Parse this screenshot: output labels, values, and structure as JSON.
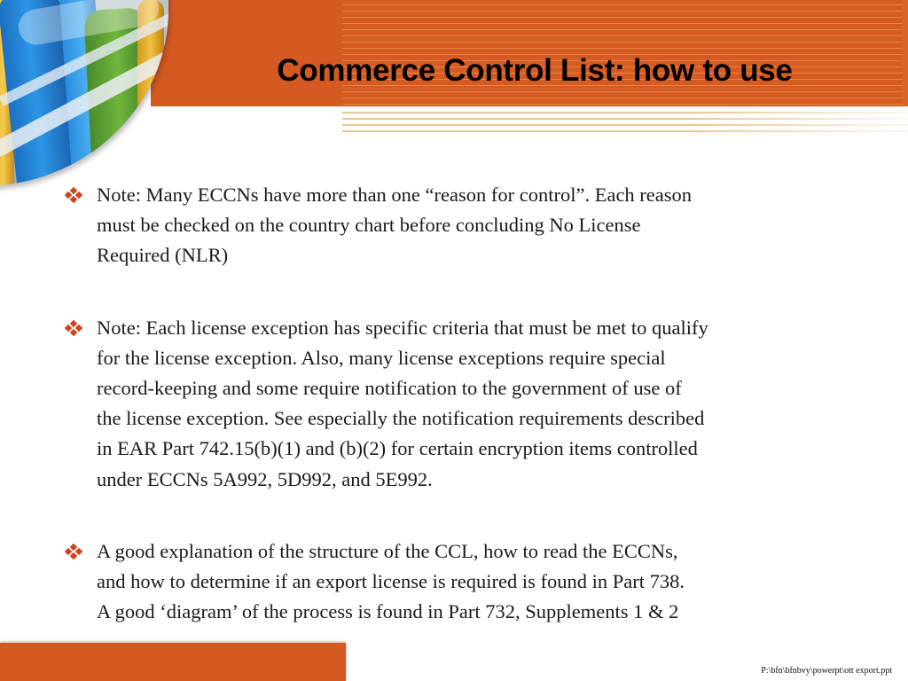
{
  "slide": {
    "title": "Commerce Control List: how to use",
    "accent_color": "#d45a22",
    "bullet_color": "#d0431f",
    "bullet_icon": "diamond-cluster-icon",
    "image": "test-tubes-photo",
    "bullets": [
      {
        "lines": [
          "Note: Many ECCNs have more than one “reason for control”.  Each reason",
          "must be checked on the country chart before concluding No License",
          "Required (NLR)"
        ]
      },
      {
        "lines": [
          "Note: Each license exception has specific criteria that must be met to qualify",
          "for the license exception.  Also, many license exceptions require special",
          "record-keeping and some require notification to the government of use of",
          "the license exception.  See especially the notification requirements described",
          "in EAR Part 742.15(b)(1) and (b)(2) for certain encryption items controlled",
          "under ECCNs 5A992, 5D992, and 5E992."
        ]
      },
      {
        "lines": [
          "A good explanation of the structure of the CCL, how to read the ECCNs,",
          "and how to determine if an export license is required is found in Part 738.",
          "A good ‘diagram’ of the process is found in Part 732, Supplements 1 & 2"
        ]
      }
    ],
    "footer_path": "P:\\bfn\\bfnbvy\\powerpt\\ott export.ppt"
  }
}
